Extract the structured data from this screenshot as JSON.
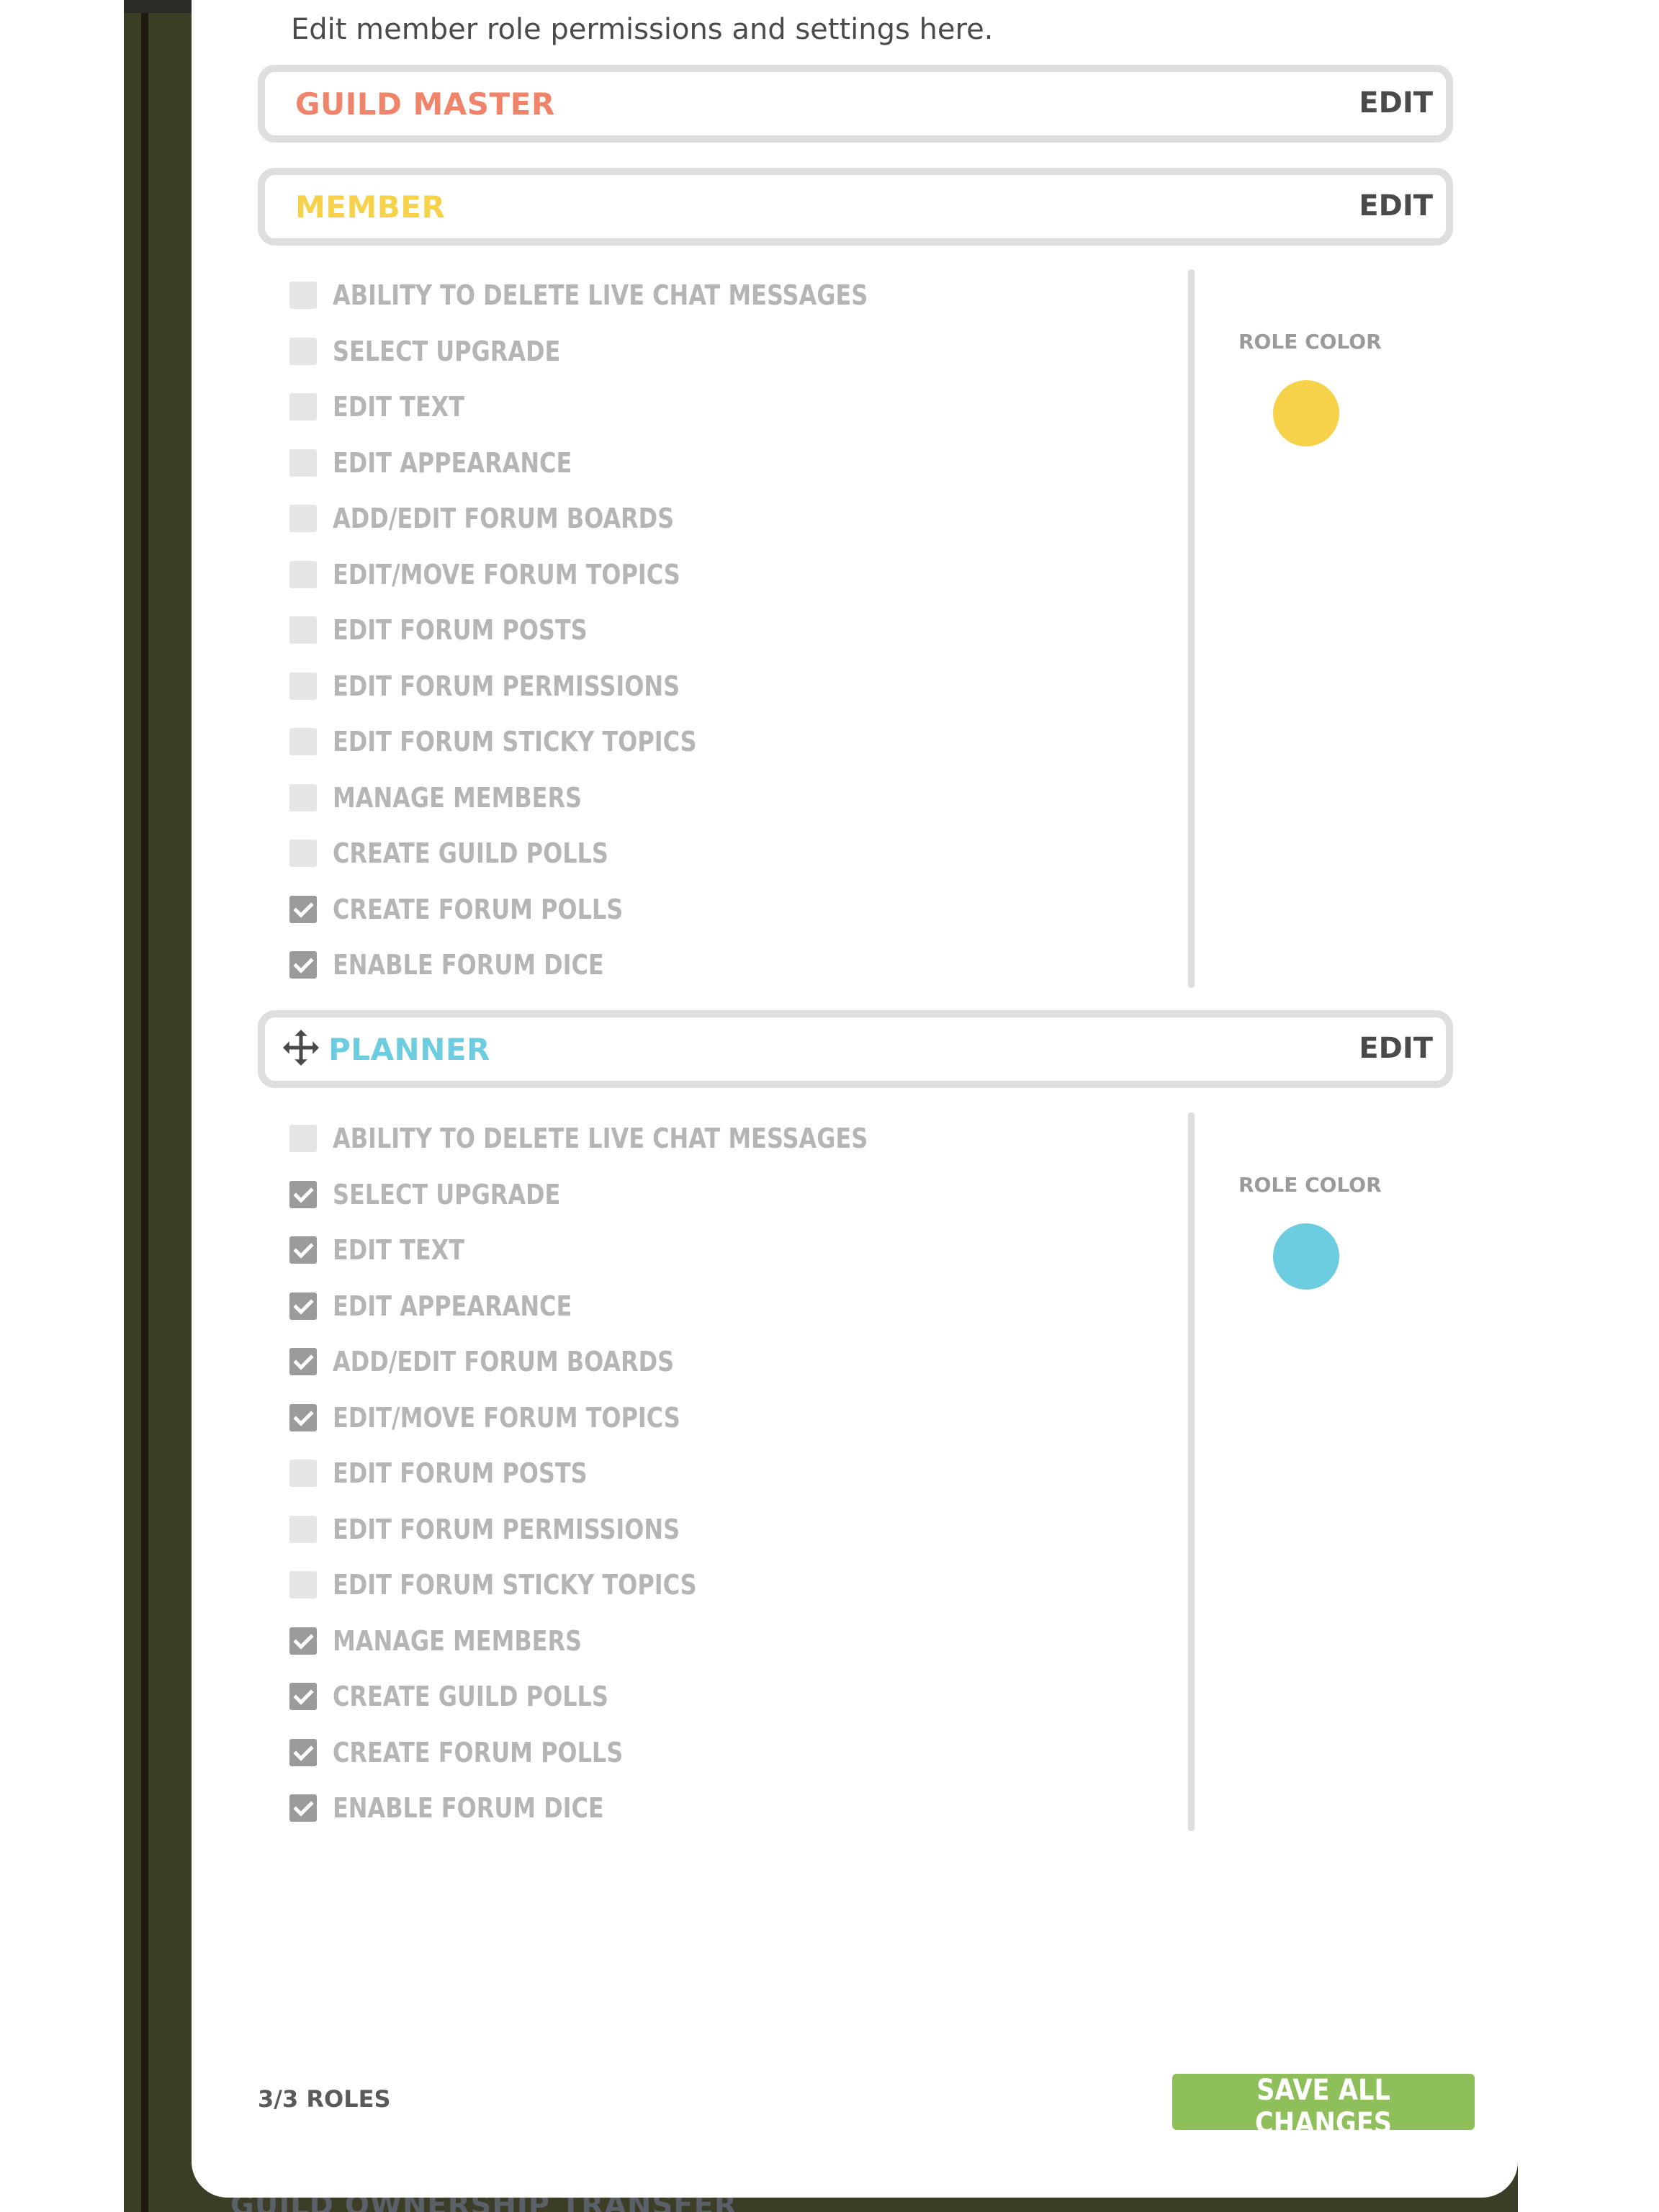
{
  "subtitle": "Edit member role permissions and settings here.",
  "edit_label": "EDIT",
  "role_color_label": "ROLE COLOR",
  "roles": [
    {
      "name": "GUILD MASTER",
      "color": "#f0846a",
      "expanded": false
    },
    {
      "name": "MEMBER",
      "color": "#f6d24a",
      "expanded": true,
      "permissions": [
        {
          "label": "ABILITY TO DELETE LIVE CHAT MESSAGES",
          "checked": false
        },
        {
          "label": "SELECT UPGRADE",
          "checked": false
        },
        {
          "label": "EDIT TEXT",
          "checked": false
        },
        {
          "label": "EDIT APPEARANCE",
          "checked": false
        },
        {
          "label": "ADD/EDIT FORUM BOARDS",
          "checked": false
        },
        {
          "label": "EDIT/MOVE FORUM TOPICS",
          "checked": false
        },
        {
          "label": "EDIT FORUM POSTS",
          "checked": false
        },
        {
          "label": "EDIT FORUM PERMISSIONS",
          "checked": false
        },
        {
          "label": "EDIT FORUM STICKY TOPICS",
          "checked": false
        },
        {
          "label": "MANAGE MEMBERS",
          "checked": false
        },
        {
          "label": "CREATE GUILD POLLS",
          "checked": false
        },
        {
          "label": "CREATE FORUM POLLS",
          "checked": true
        },
        {
          "label": "ENABLE FORUM DICE",
          "checked": true
        }
      ]
    },
    {
      "name": "PLANNER",
      "color": "#6dcde0",
      "expanded": true,
      "permissions": [
        {
          "label": "ABILITY TO DELETE LIVE CHAT MESSAGES",
          "checked": false
        },
        {
          "label": "SELECT UPGRADE",
          "checked": true
        },
        {
          "label": "EDIT TEXT",
          "checked": true
        },
        {
          "label": "EDIT APPEARANCE",
          "checked": true
        },
        {
          "label": "ADD/EDIT FORUM BOARDS",
          "checked": true
        },
        {
          "label": "EDIT/MOVE FORUM TOPICS",
          "checked": true
        },
        {
          "label": "EDIT FORUM POSTS",
          "checked": false
        },
        {
          "label": "EDIT FORUM PERMISSIONS",
          "checked": false
        },
        {
          "label": "EDIT FORUM STICKY TOPICS",
          "checked": false
        },
        {
          "label": "MANAGE MEMBERS",
          "checked": true
        },
        {
          "label": "CREATE GUILD POLLS",
          "checked": true
        },
        {
          "label": "CREATE FORUM POLLS",
          "checked": true
        },
        {
          "label": "ENABLE FORUM DICE",
          "checked": true
        }
      ]
    }
  ],
  "roles_count": "3/3 ROLES",
  "save_label": "SAVE ALL CHANGES",
  "background_footer_text": "GUILD OWNERSHIP TRANSFER"
}
